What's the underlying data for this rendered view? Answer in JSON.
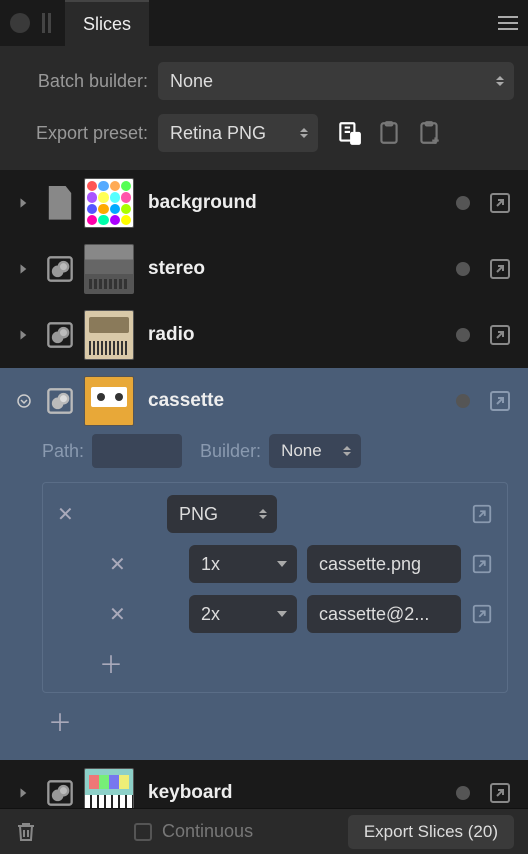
{
  "panel": {
    "title": "Slices"
  },
  "controls": {
    "batch_label": "Batch builder:",
    "batch_value": "None",
    "preset_label": "Export preset:",
    "preset_value": "Retina PNG"
  },
  "slices": [
    {
      "name": "background"
    },
    {
      "name": "stereo"
    },
    {
      "name": "radio"
    },
    {
      "name": "cassette"
    },
    {
      "name": "keyboard"
    }
  ],
  "detail": {
    "path_label": "Path:",
    "builder_label": "Builder:",
    "builder_value": "None",
    "format": "PNG",
    "outputs": [
      {
        "scale": "1x",
        "filename": "cassette.png"
      },
      {
        "scale": "2x",
        "filename": "cassette@2..."
      }
    ]
  },
  "footer": {
    "continuous_label": "Continuous",
    "export_label": "Export Slices (20)"
  }
}
